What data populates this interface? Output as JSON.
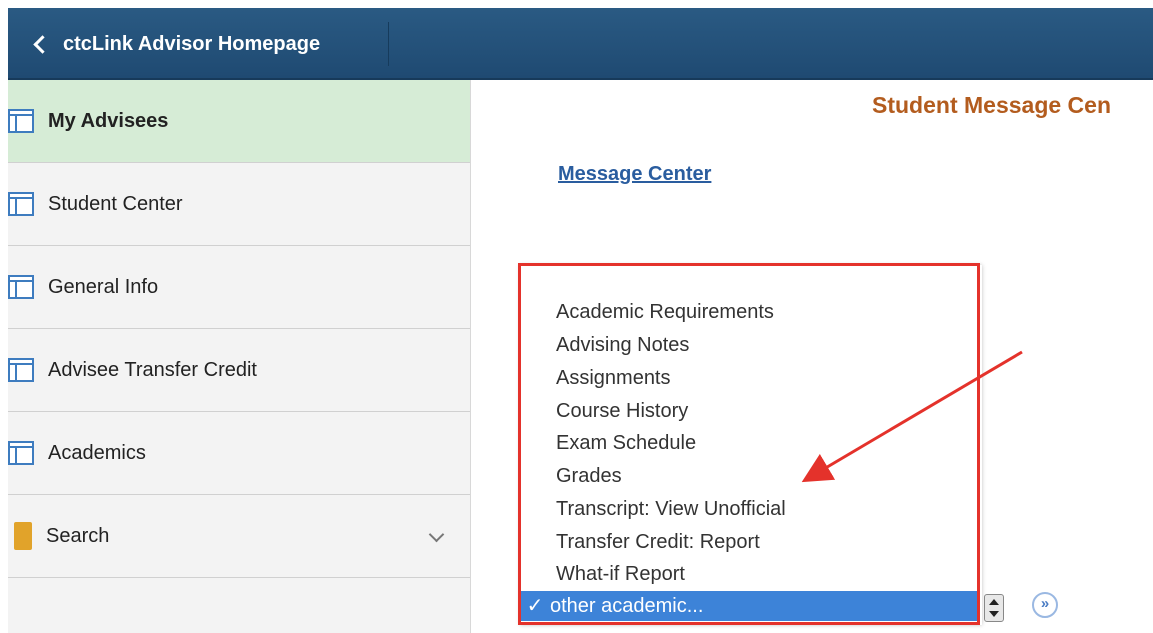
{
  "header": {
    "back_label": "ctcLink Advisor Homepage"
  },
  "sidebar": {
    "items": [
      {
        "label": "My Advisees",
        "icon": "page-icon",
        "active": true
      },
      {
        "label": "Student Center",
        "icon": "page-icon"
      },
      {
        "label": "General Info",
        "icon": "page-icon"
      },
      {
        "label": "Advisee Transfer Credit",
        "icon": "page-icon"
      },
      {
        "label": "Academics",
        "icon": "page-icon"
      },
      {
        "label": "Search",
        "icon": "folder-icon",
        "expandable": true
      }
    ]
  },
  "main": {
    "title": "Student Message Cen",
    "message_center_link": "Message Center",
    "dropdown": {
      "options": [
        "Academic Requirements",
        "Advising Notes",
        "Assignments",
        "Course History",
        "Exam Schedule",
        "Grades",
        "Transcript: View Unofficial",
        "Transfer Credit: Report",
        "What-if Report"
      ],
      "selected": "other academic...",
      "check_mark": "✓"
    },
    "go_button_glyph": "»"
  },
  "colors": {
    "header": "#1f4a72",
    "active_item": "#d6ecd6",
    "title": "#b35c1e",
    "link": "#2a5d9f",
    "highlight": "#e4322b",
    "selected_option": "#3d83d8"
  }
}
